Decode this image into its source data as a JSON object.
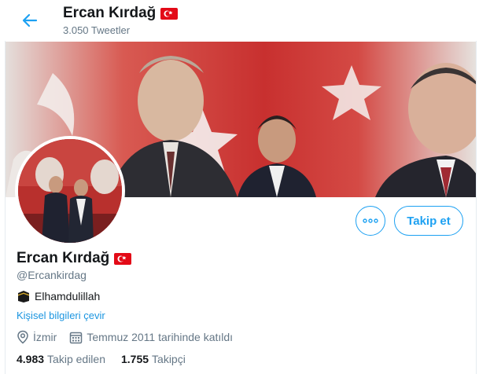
{
  "header": {
    "title": "Ercan Kırdağ",
    "tweet_count": "3.050 Tweetler"
  },
  "profile": {
    "name": "Ercan Kırdağ",
    "handle": "@Ercankirdag",
    "bio": "Elhamdulillah",
    "translate_link": "Kişisel bilgileri çevir",
    "location": "İzmir",
    "joined": "Temmuz 2011 tarihinde katıldı",
    "following_count": "4.983",
    "following_label": "Takip edilen",
    "followers_count": "1.755",
    "followers_label": "Takipçi"
  },
  "actions": {
    "more_label": "ooo",
    "follow_label": "Takip et"
  },
  "icons": {
    "back": "arrow-left-icon",
    "flag": "turkey-flag-icon",
    "kaaba": "kaaba-emoji-icon",
    "location": "location-pin-icon",
    "calendar": "calendar-icon",
    "more": "more-dots-icon"
  },
  "colors": {
    "accent": "#1da1f2",
    "secondary_text": "#657786",
    "link": "#1b95e0",
    "flag_red": "#e30a17"
  }
}
